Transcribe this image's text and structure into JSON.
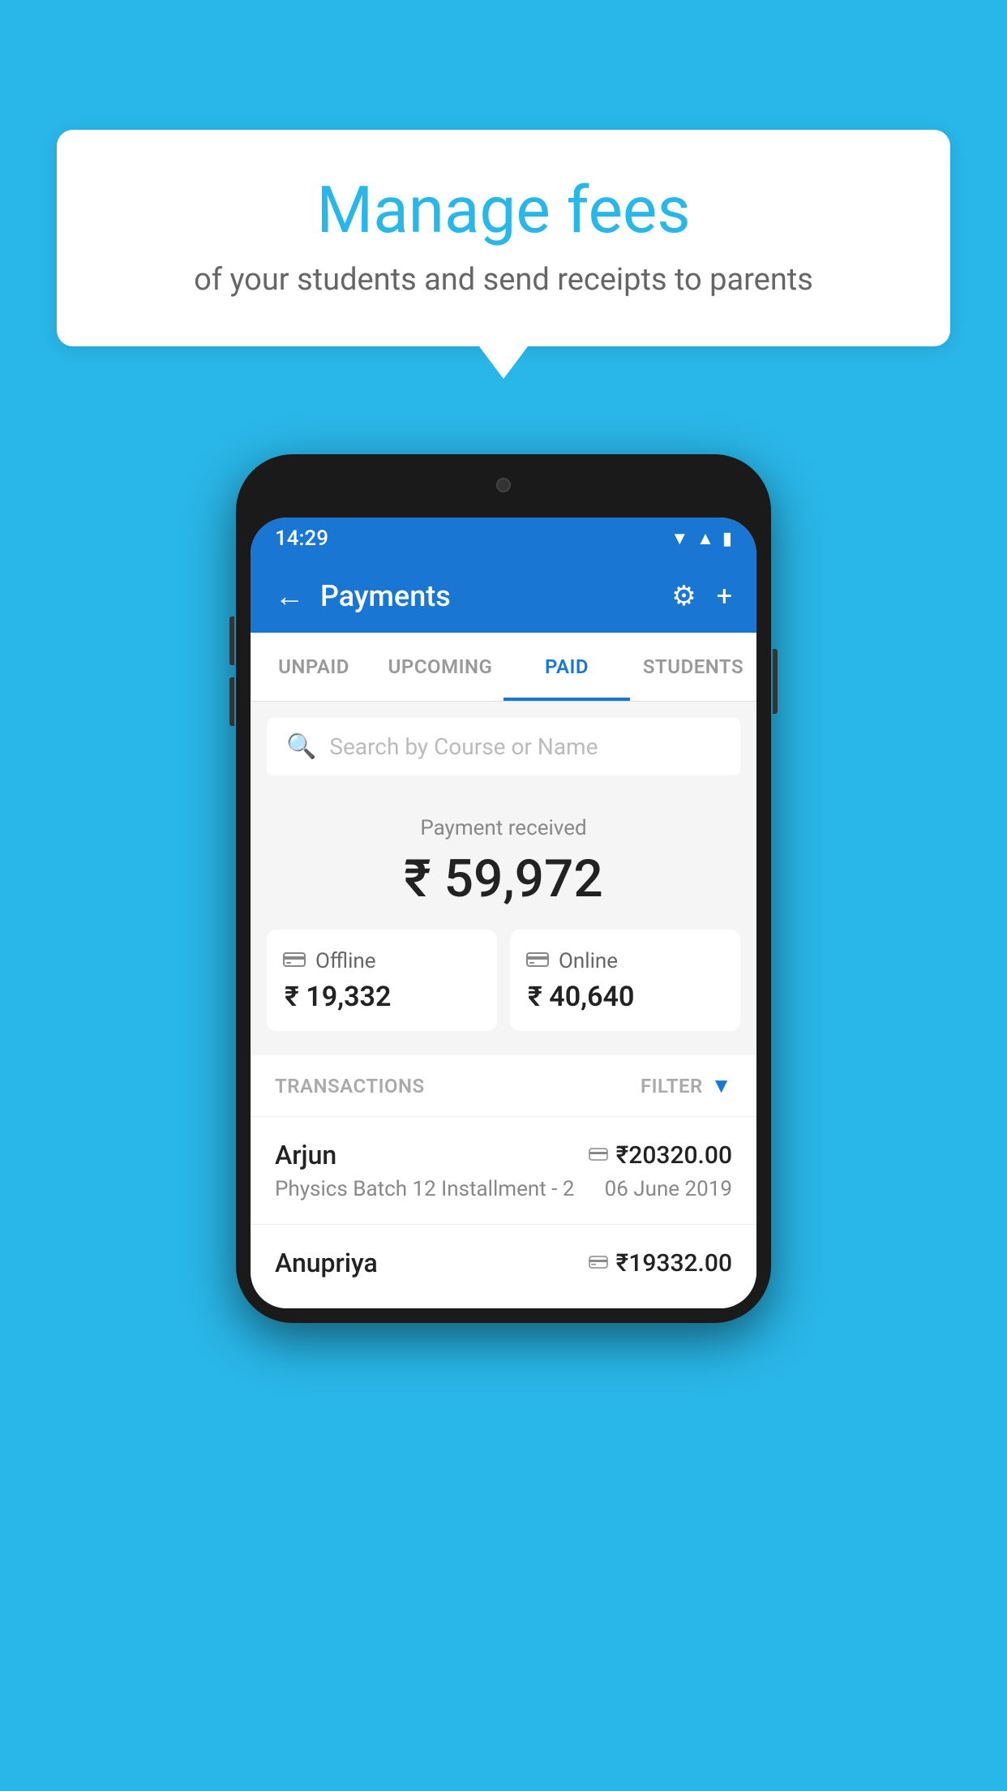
{
  "background_color": "#29B6E8",
  "speech_bubble": {
    "title": "Manage fees",
    "subtitle": "of your students and send receipts to parents"
  },
  "status_bar": {
    "time": "14:29",
    "icons": [
      "wifi",
      "signal",
      "battery"
    ]
  },
  "app_bar": {
    "title": "Payments",
    "back_icon": "←",
    "settings_icon": "⚙",
    "add_icon": "+"
  },
  "tabs": [
    {
      "label": "UNPAID",
      "active": false
    },
    {
      "label": "UPCOMING",
      "active": false
    },
    {
      "label": "PAID",
      "active": true
    },
    {
      "label": "STUDENTS",
      "active": false
    }
  ],
  "search": {
    "placeholder": "Search by Course or Name"
  },
  "payment_summary": {
    "label": "Payment received",
    "total": "₹ 59,972",
    "offline": {
      "icon": "💳",
      "label": "Offline",
      "amount": "₹ 19,332"
    },
    "online": {
      "icon": "💳",
      "label": "Online",
      "amount": "₹ 40,640"
    }
  },
  "transactions": {
    "header_label": "TRANSACTIONS",
    "filter_label": "FILTER",
    "items": [
      {
        "name": "Arjun",
        "course": "Physics Batch 12 Installment - 2",
        "date": "06 June 2019",
        "amount": "₹20320.00",
        "payment_type": "online"
      },
      {
        "name": "Anupriya",
        "course": "",
        "date": "",
        "amount": "₹19332.00",
        "payment_type": "offline"
      }
    ]
  }
}
